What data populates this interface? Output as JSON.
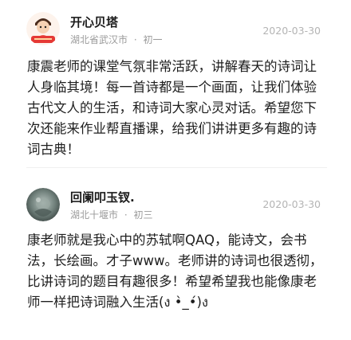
{
  "comments": [
    {
      "username": "开心贝塔",
      "location": "湖北省武汉市",
      "grade": "初一",
      "date": "2020-03-30",
      "content": "康震老师的课堂气氛非常活跃，讲解春天的诗词让人身临其境！每一首诗都是一个画面，让我们体验古代文人的生活，和诗词大家心灵对话。希望您下次还能来作业帮直播课，给我们讲讲更多有趣的诗词古典！",
      "avatar_icon": "cartoon-character-avatar-icon"
    },
    {
      "username": "回阑叩玉钗.",
      "location": "湖北十堰市",
      "grade": "初三",
      "date": "2020-03-30",
      "content": "康老师就是我心中的苏轼啊QAQ，能诗文，会书法，长绘画。才子www。老师讲的诗词也很透彻，比讲诗词的题目有趣很多！希望希望我也能像康老师一样把诗词融入生活(ง •̀_•́)ง",
      "avatar_icon": "photo-avatar-icon"
    }
  ],
  "separator": "·"
}
